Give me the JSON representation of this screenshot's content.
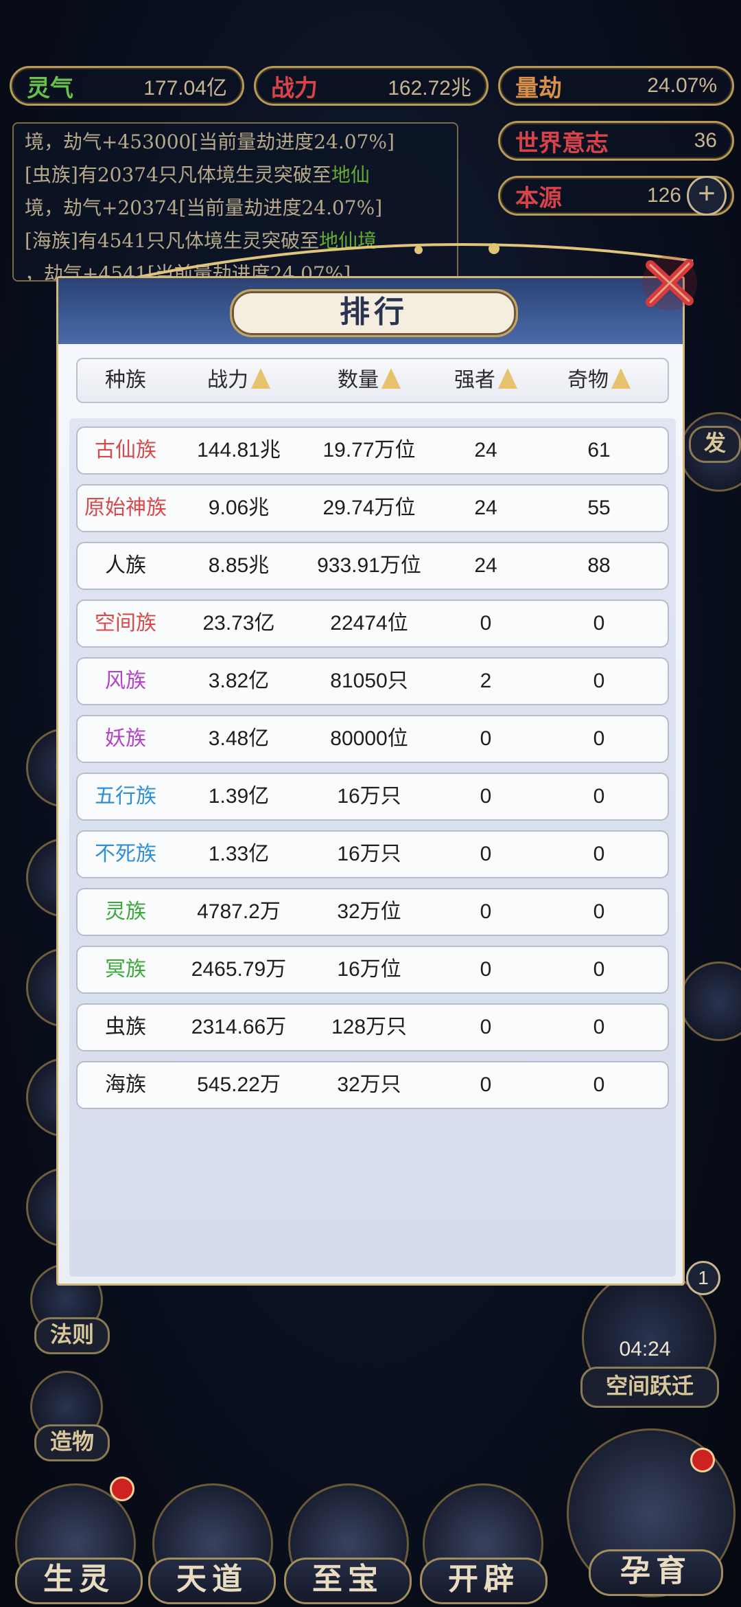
{
  "stats": {
    "lingqi": {
      "label": "灵气",
      "value": "177.04亿",
      "color": "#66c24a"
    },
    "zhanli": {
      "label": "战力",
      "value": "162.72兆",
      "color": "#d8434a"
    },
    "liangjie": {
      "label": "量劫",
      "value": "24.07%",
      "color": "#d9904a"
    },
    "world_will": {
      "label": "世界意志",
      "value": "36",
      "color": "#d8434a"
    },
    "source": {
      "label": "本源",
      "value": "126",
      "color": "#d8434a"
    }
  },
  "log_lines": [
    {
      "pre": "境，劫气+453000[当前量劫进度24.07%]",
      "green": "",
      "post": ""
    },
    {
      "pre": "[虫族]有20374只凡体境生灵突破至",
      "green": "地仙",
      "post": ""
    },
    {
      "pre": "境，劫气+20374[当前量劫进度24.07%]",
      "green": "",
      "post": ""
    },
    {
      "pre": "[海族]有4541只凡体境生灵突破至",
      "green": "地仙境",
      "post": ""
    },
    {
      "pre": "，劫气+4541[当前量劫进度24.07%]",
      "green": "",
      "post": ""
    }
  ],
  "side_labels": {
    "law": "法则",
    "create": "造物",
    "space_jump": "空间跃迁",
    "timer": "04:24",
    "badge": "1",
    "right_fa": "发"
  },
  "bottom_nav": [
    "生灵",
    "天道",
    "至宝",
    "开辟",
    "孕育"
  ],
  "modal": {
    "title": "排行",
    "columns": [
      "种族",
      "战力",
      "数量",
      "强者",
      "奇物"
    ],
    "rows": [
      {
        "race": "古仙族",
        "power": "144.81兆",
        "count": "19.77万位",
        "strong": "24",
        "treasure": "61",
        "color": "#d84a4a"
      },
      {
        "race": "原始神族",
        "power": "9.06兆",
        "count": "29.74万位",
        "strong": "24",
        "treasure": "55",
        "color": "#d84a4a"
      },
      {
        "race": "人族",
        "power": "8.85兆",
        "count": "933.91万位",
        "strong": "24",
        "treasure": "88",
        "color": "#1d1d1d"
      },
      {
        "race": "空间族",
        "power": "23.73亿",
        "count": "22474位",
        "strong": "0",
        "treasure": "0",
        "color": "#d84a4a"
      },
      {
        "race": "风族",
        "power": "3.82亿",
        "count": "81050只",
        "strong": "2",
        "treasure": "0",
        "color": "#b443c9"
      },
      {
        "race": "妖族",
        "power": "3.48亿",
        "count": "80000位",
        "strong": "0",
        "treasure": "0",
        "color": "#b443c9"
      },
      {
        "race": "五行族",
        "power": "1.39亿",
        "count": "16万只",
        "strong": "0",
        "treasure": "0",
        "color": "#2f8fd6"
      },
      {
        "race": "不死族",
        "power": "1.33亿",
        "count": "16万只",
        "strong": "0",
        "treasure": "0",
        "color": "#2f8fd6"
      },
      {
        "race": "灵族",
        "power": "4787.2万",
        "count": "32万位",
        "strong": "0",
        "treasure": "0",
        "color": "#3aa83a"
      },
      {
        "race": "冥族",
        "power": "2465.79万",
        "count": "16万位",
        "strong": "0",
        "treasure": "0",
        "color": "#3aa83a"
      },
      {
        "race": "虫族",
        "power": "2314.66万",
        "count": "128万只",
        "strong": "0",
        "treasure": "0",
        "color": "#1d1d1d"
      },
      {
        "race": "海族",
        "power": "545.22万",
        "count": "32万只",
        "strong": "0",
        "treasure": "0",
        "color": "#1d1d1d"
      }
    ]
  },
  "icons": {
    "close": "close-x-icon",
    "sort": "sort-arrow-icon",
    "plus": "plus-icon"
  }
}
